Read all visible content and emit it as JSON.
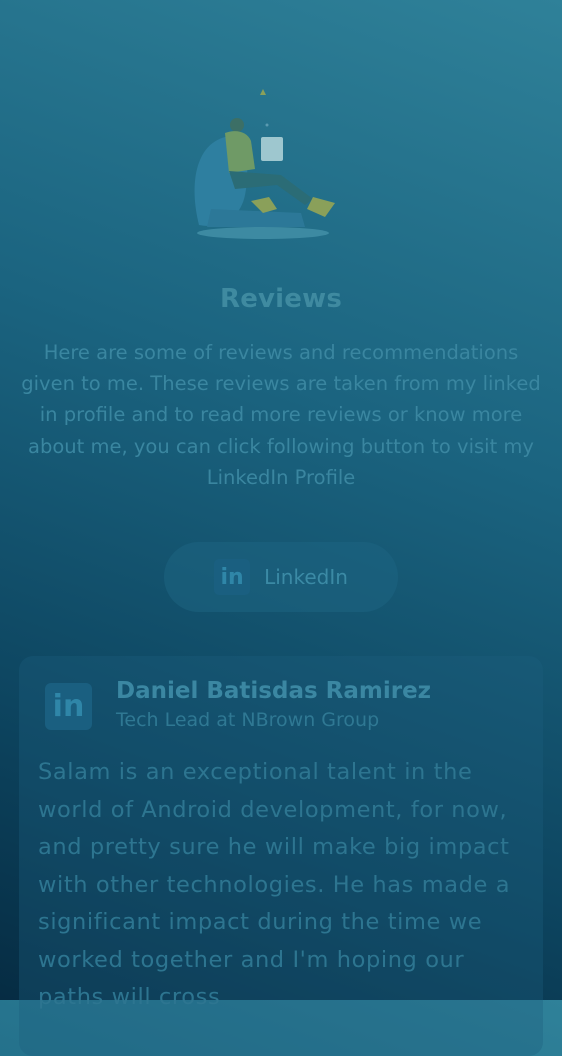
{
  "section": {
    "title": "Reviews",
    "intro": "Here are some of reviews and recommendations given to me. These reviews are taken from my linked in profile and to read more reviews or know more about me, you can click following button to visit my LinkedIn Profile",
    "illustration_icon": "person-reading-on-beanbag-illustration"
  },
  "linkedin_button": {
    "label": "LinkedIn",
    "icon": "linkedin-icon",
    "icon_text": "in"
  },
  "review": {
    "name": "Daniel Batisdas Ramirez",
    "role": "Tech Lead at NBrown Group",
    "icon": "linkedin-icon",
    "icon_text": "in",
    "text": "Salam is an exceptional talent in the world of Android development, for now, and pretty sure he will make big impact with other technologies. He has made a significant impact during the time we worked together and I'm hoping our paths will cross"
  },
  "colors": {
    "background_top": "#2f8199",
    "background_bottom": "#062c43",
    "text_accent": "#3b87a2"
  }
}
